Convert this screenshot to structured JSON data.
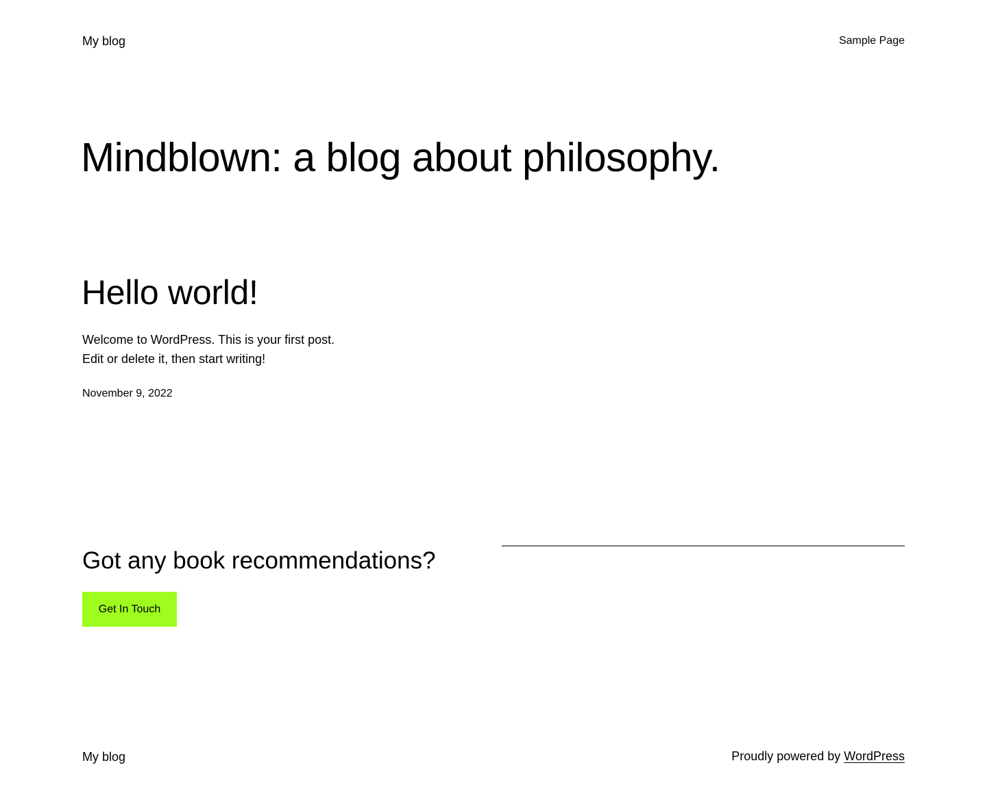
{
  "header": {
    "site_title": "My blog",
    "nav_items": [
      {
        "label": "Sample Page"
      }
    ]
  },
  "hero": {
    "title": "Mindblown: a blog about philosophy."
  },
  "post": {
    "title": "Hello world!",
    "excerpt": "Welcome to WordPress. This is your first post. Edit or delete it, then start writing!",
    "date": "November 9, 2022"
  },
  "cta": {
    "heading": "Got any book recommendations?",
    "button_label": "Get In Touch",
    "button_color": "#9efc1f"
  },
  "footer": {
    "site_title": "My blog",
    "credit_prefix": "Proudly powered by ",
    "credit_link": "WordPress"
  }
}
